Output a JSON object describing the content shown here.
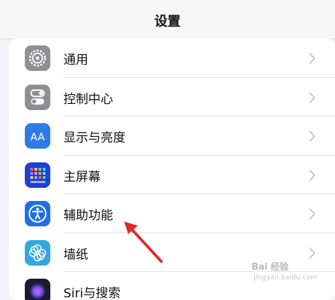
{
  "nav": {
    "title": "设置"
  },
  "settings": {
    "items": [
      {
        "label": "通用",
        "icon": "gear-icon",
        "color": "#8e8e93"
      },
      {
        "label": "控制中心",
        "icon": "control-center-icon",
        "color": "#8e8e93"
      },
      {
        "label": "显示与亮度",
        "icon": "display-brightness-icon",
        "color": "#2f7be6"
      },
      {
        "label": "主屏幕",
        "icon": "home-screen-icon",
        "color": "#1f3fd6"
      },
      {
        "label": "辅助功能",
        "icon": "accessibility-icon",
        "color": "#1f6fe6"
      },
      {
        "label": "墙纸",
        "icon": "wallpaper-icon",
        "color": "#34a6e0"
      },
      {
        "label": "Siri与搜索",
        "icon": "siri-icon",
        "color": "#1b1b2f"
      }
    ]
  },
  "annotation": {
    "arrow_color": "#e02a2a"
  },
  "watermark": {
    "line1": "Bai 经验",
    "line2": "jingyan.baidu.com"
  }
}
